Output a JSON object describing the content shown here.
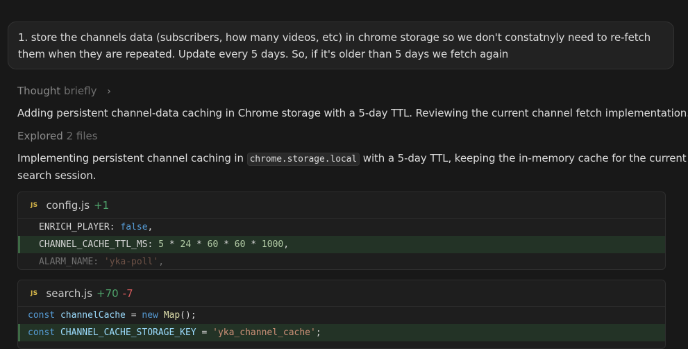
{
  "user_message": {
    "line1": "1. store the channels data (subscribers, how many videos, etc) in chrome storage so we don't constatnyly need to re-fetch",
    "line2": "them when they are repeated. Update every 5 days. So, if it's older than 5 days we fetch again"
  },
  "thought": {
    "label": "Thought",
    "detail": "briefly"
  },
  "message1": "Adding persistent channel-data caching in Chrome storage with a 5-day TTL. Reviewing the current channel fetch implementation.",
  "explored": {
    "label": "Explored",
    "detail": "2 files"
  },
  "message2": {
    "before": "Implementing persistent channel caching in ",
    "code": "chrome.storage.local",
    "after": " with a 5-day TTL, keeping the in-memory cache for the current",
    "line2": "search session."
  },
  "diffs": [
    {
      "lang_badge": "JS",
      "filename": "config.js",
      "additions": "+1",
      "deletions": "",
      "lines": [
        {
          "text": "ENRICH_PLAYER: false,"
        },
        {
          "text": "CHANNEL_CACHE_TTL_MS: 5 * 24 * 60 * 60 * 1000,"
        },
        {
          "text": "ALARM_NAME: 'yka-poll',"
        }
      ]
    },
    {
      "lang_badge": "JS",
      "filename": "search.js",
      "additions": "+70",
      "deletions": "-7",
      "lines": [
        {
          "text": "const channelCache = new Map();"
        },
        {
          "text": "const CHANNEL_CACHE_STORAGE_KEY = 'yka_channel_cache';"
        }
      ]
    }
  ],
  "colors": {
    "background": "#181818",
    "added_line": "#233326",
    "additions": "#4fa36b",
    "deletions": "#d0585a",
    "js_badge": "#d9b84a"
  }
}
